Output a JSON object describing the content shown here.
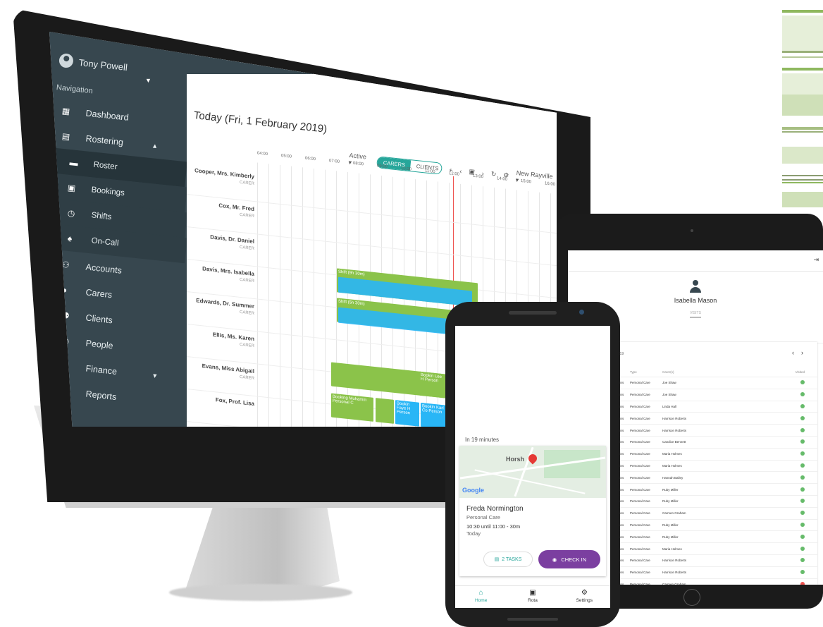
{
  "desktop": {
    "user_name": "Tony Powell",
    "nav_label": "Navigation",
    "nav_items": [
      {
        "label": "Dashboard",
        "icon": "dashboard-icon"
      },
      {
        "label": "Rostering",
        "icon": "calendar-icon"
      },
      {
        "label": "Roster",
        "icon": "roster-icon",
        "sub": true,
        "active": true
      },
      {
        "label": "Bookings",
        "icon": "calendar-day-icon",
        "sub": true
      },
      {
        "label": "Shifts",
        "icon": "clock-icon",
        "sub": true
      },
      {
        "label": "On-Call",
        "icon": "bell-icon",
        "sub": true
      },
      {
        "label": "Accounts",
        "icon": "accounts-icon"
      },
      {
        "label": "Carers",
        "icon": "person-circle-icon"
      },
      {
        "label": "Clients",
        "icon": "people-icon"
      },
      {
        "label": "People",
        "icon": "face-icon"
      },
      {
        "label": "Finance",
        "icon": "bank-icon"
      },
      {
        "label": "Reports",
        "icon": "clipboard-icon"
      }
    ],
    "page_title": "Today (Fri, 1 February 2019)",
    "filter_active": "Active",
    "toggle_carers": "CARERS",
    "toggle_clients": "CLIENTS",
    "location": "New Rayville",
    "hours": [
      "04:00",
      "05:00",
      "06:00",
      "07:00",
      "08:00",
      "09:00",
      "10:00",
      "11:00",
      "12:00",
      "13:00",
      "14:00",
      "15:00",
      "16:00"
    ],
    "rows": [
      {
        "name": "Cooper, Mrs. Kimberly",
        "role": "CARER"
      },
      {
        "name": "Cox, Mr. Fred",
        "role": "CARER"
      },
      {
        "name": "Davis, Dr. Daniel",
        "role": "CARER"
      },
      {
        "name": "Davis, Mrs. Isabella",
        "role": "CARER"
      },
      {
        "name": "Edwards, Dr. Summer",
        "role": "CARER"
      },
      {
        "name": "Ellis, Ms. Karen",
        "role": "CARER"
      },
      {
        "name": "Evans, Miss Abigail",
        "role": "CARER"
      },
      {
        "name": "Fox, Prof. Lisa",
        "role": ""
      }
    ],
    "blocks": {
      "shift1": "Shift (9h 30m)",
      "shift2": "Shift (5h 30m)",
      "booking1": "Booking Muhamm Personal C",
      "booking2": "Bookin Faye H Person",
      "booking3": "Bookin Karl Co Person",
      "booking4": "Bookin Lee H Person"
    }
  },
  "tablet": {
    "person_name": "Isabella Mason",
    "sub_tab": "VISITS",
    "date_label": "2019",
    "columns": [
      "",
      "Type",
      "Carer(s)",
      "Visited"
    ],
    "rows": [
      {
        "dur": "5 mins",
        "type": "Personal Care",
        "carer": "Joe Shaw",
        "ok": true
      },
      {
        "dur": "0 mins",
        "type": "Personal Care",
        "carer": "Joe Shaw",
        "ok": true
      },
      {
        "dur": "0 mins",
        "type": "Personal Care",
        "carer": "Linda Hall",
        "ok": true
      },
      {
        "dur": "5 mins",
        "type": "Personal Care",
        "carer": "Harrison Roberts",
        "ok": true
      },
      {
        "dur": "0 mins",
        "type": "Personal Care",
        "carer": "Harrison Roberts",
        "ok": true
      },
      {
        "dur": "5 mins",
        "type": "Personal Care",
        "carer": "Candice Bennett",
        "ok": true
      },
      {
        "dur": "0 mins",
        "type": "Personal Care",
        "carer": "Maria Holmes",
        "ok": true
      },
      {
        "dur": "5 mins",
        "type": "Personal Care",
        "carer": "Maria Holmes",
        "ok": true
      },
      {
        "dur": "0 mins",
        "type": "Personal Care",
        "carer": "Hannah Bailey",
        "ok": true
      },
      {
        "dur": "0 mins",
        "type": "Personal Care",
        "carer": "Ruby Miller",
        "ok": true
      },
      {
        "dur": "0 mins",
        "type": "Personal Care",
        "carer": "Ruby Miller",
        "ok": true
      },
      {
        "dur": "0 mins",
        "type": "Personal Care",
        "carer": "Carmen Graham",
        "ok": true
      },
      {
        "dur": "0 mins",
        "type": "Personal Care",
        "carer": "Ruby Miller",
        "ok": true
      },
      {
        "dur": "0 mins",
        "type": "Personal Care",
        "carer": "Ruby Miller",
        "ok": true
      },
      {
        "dur": "5 mins",
        "type": "Personal Care",
        "carer": "Maria Holmes",
        "ok": true
      },
      {
        "dur": "5 mins",
        "type": "Personal Care",
        "carer": "Harrison Roberts",
        "ok": true
      },
      {
        "dur": "0 mins",
        "type": "Personal Care",
        "carer": "Harrison Roberts",
        "ok": true
      },
      {
        "dur": "0 mins",
        "type": "Personal Care",
        "carer": "Carmen Graham",
        "ok": false
      },
      {
        "dur": "0 mins",
        "type": "Personal Care",
        "carer": "Ruby Miller",
        "ok": true
      }
    ]
  },
  "phone": {
    "eta": "In 19 minutes",
    "map_town": "Horsh",
    "map_logo": "Google",
    "client": "Freda Normington",
    "type": "Personal Care",
    "time": "10:30 until 11:00 - 30m",
    "when": "Today",
    "tasks_label": "2 TASKS",
    "checkin_label": "CHECK IN",
    "nav": [
      {
        "label": "Home",
        "icon": "home-icon",
        "active": true
      },
      {
        "label": "Rota",
        "icon": "calendar-icon"
      },
      {
        "label": "Settings",
        "icon": "gear-icon"
      }
    ]
  },
  "colors": {
    "accent": "#26a69a",
    "sidebar": "#37474f",
    "checkin": "#7b3fa0",
    "shift_green": "#8bc34a",
    "booking_blue": "#29b6f6"
  }
}
